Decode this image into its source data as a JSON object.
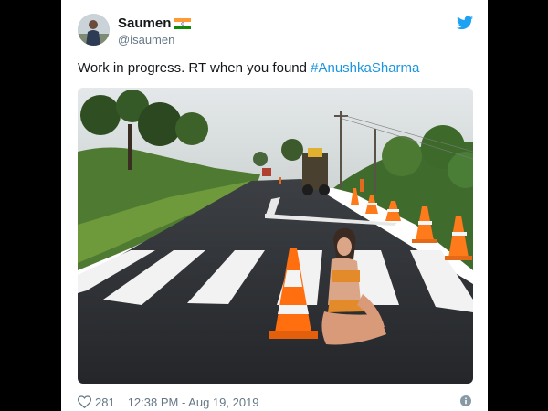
{
  "tweet": {
    "author": {
      "display_name": "Saumen",
      "handle": "@isaumen",
      "flag_icon": "india-flag-icon"
    },
    "text_prefix": "Work in progress. RT when you found ",
    "hashtag": "#AnushkaSharma",
    "likes": "281",
    "timestamp": "12:38 PM - Aug 19, 2019",
    "colors": {
      "link": "#1b95e0",
      "twitter_blue": "#1da1f2",
      "muted": "#657786",
      "text": "#14171a"
    }
  },
  "icons": {
    "brand": "twitter-bird-icon",
    "like": "heart-icon",
    "info": "info-icon"
  }
}
